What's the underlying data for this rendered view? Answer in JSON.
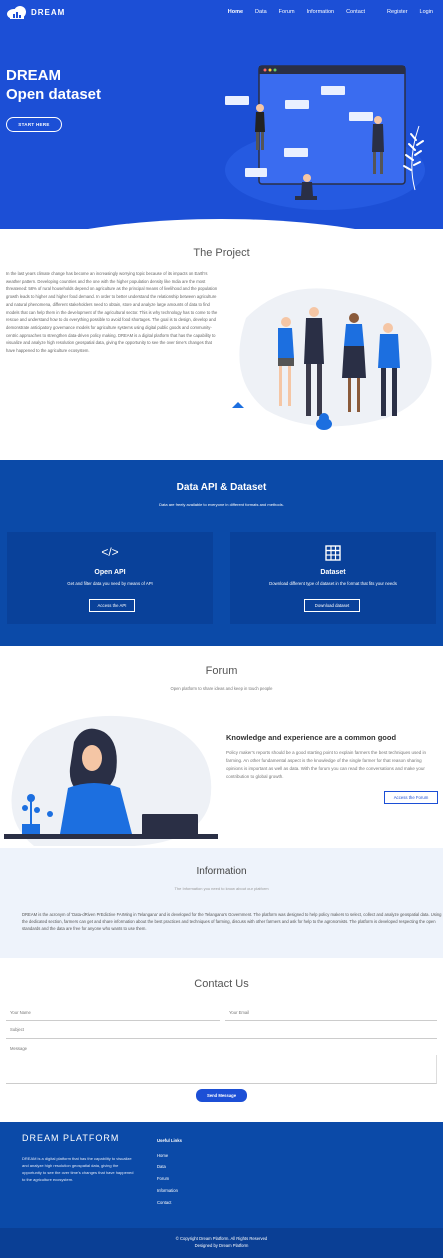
{
  "nav": {
    "logo_text": "DREAM",
    "links": [
      "Home",
      "Data",
      "Forum",
      "Information",
      "Contact"
    ],
    "register": "Register",
    "login": "Login"
  },
  "hero": {
    "title_line1": "DREAM",
    "title_line2": "Open dataset",
    "button": "START HERE"
  },
  "project": {
    "title": "The Project",
    "text": "In the last years climate change has become an increasingly worrying topic because of its impacts on Earth's weather pattern. Developing countries and the one with the higher population density like India are the most threatened: 58% of rural households depend on agriculture as the principal means of livelihood and the population growth leads to higher and higher food demand. In order to better understand the relationship between agriculture and natural phenomena, different stakeholders need to obtain, store and analyze large amounts of data to find models that can help them in the development of the agricultural sector. This is why technology has to come to the rescue and understand how to do everything possible to avoid food shortages. The goal is to design, develop and demonstrate anticipatory governance models for agriculture systems using digital public goods and community-centric approaches to strengthen data-driven policy making. DREAM is a digital platform that has the capability to visualize and analyze high resolution geospatial data, giving the opportunity to see the over time's changes that have happened to the agriculture ecosystem."
  },
  "data": {
    "title": "Data API & Dataset",
    "subtitle": "Data are freely available to everyone in different formats and methods.",
    "cards": [
      {
        "icon": "code-icon",
        "title": "Open API",
        "desc": "Get and filter data you need by means of API",
        "button": "Access the API"
      },
      {
        "icon": "table-icon",
        "title": "Dataset",
        "desc": "Download different type of dataset in the format that fits your needs",
        "button": "Download dataset"
      }
    ]
  },
  "forum": {
    "title": "Forum",
    "subtitle": "Open platform to share ideas and keep in touch people",
    "heading": "Knowledge and experience are a common good",
    "text": "Policy maker's reports should be a good starting point to explain farmers the best techniques used in farming. An other fundamental aspect is the knowledge of the single farmer for that reason sharing opinions is important as well as data. With the forum you can read the conversations and make your contribution to global growth.",
    "button": "Access the Forum"
  },
  "information": {
    "title": "Information",
    "subtitle": "The Information you need to know about our platform",
    "text": "DREAM is the acronym of 'Data-dRiven PrEdictive FArMing in Telangana' and is developed for the Telangana's Government. The platform was designed to help policy makers to select, collect and analyze geospatial data. Using the dedicated section, farmers can get and share information about the best practices and techniques of farming, discuss with other farmers and ask for help to the agronomists. The platform is developed respecting the open standards and the data are free for anyone who wants to use them."
  },
  "contact": {
    "title": "Contact Us",
    "name_label": "Your Name",
    "email_label": "Your Email",
    "subject_label": "Subject",
    "message_label": "Message",
    "button": "Send Message"
  },
  "footer": {
    "brand": "DREAM PLATFORM",
    "desc": "DREAM is a digital platform that has the capability to visualize and analyze high resolution geospatial data, giving the opportunity to see the over time's changes that have happened to the agriculture ecosystem.",
    "links_title": "Useful Links",
    "links": [
      "Home",
      "Data",
      "Forum",
      "Information",
      "Contact"
    ],
    "copyright": "© Copyright Dream Platform. All Rights Reserved",
    "designed": "Designed by Dream Platform"
  },
  "colors": {
    "primary": "#1c4fd6",
    "section_dark": "#0b4aa8",
    "light_bg": "#eef3fb"
  }
}
